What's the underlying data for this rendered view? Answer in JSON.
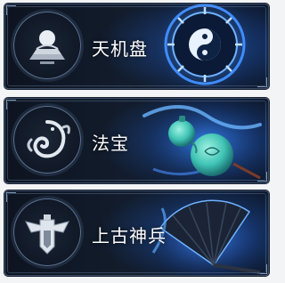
{
  "menu": {
    "items": [
      {
        "label": "天机盘",
        "icon": "orb-pedestal-icon",
        "art": "taiji-bagua-wheel-illustration"
      },
      {
        "label": "法宝",
        "icon": "dragon-cloud-icon",
        "art": "jade-gourd-illustration"
      },
      {
        "label": "上古神兵",
        "icon": "winged-armor-icon",
        "art": "war-fan-illustration"
      }
    ]
  },
  "colors": {
    "card_bg": "#0d1420",
    "glow_blue": "#2f7ef0",
    "emblem_silver": "#cfd6df",
    "jade": "#3fc3b4"
  }
}
